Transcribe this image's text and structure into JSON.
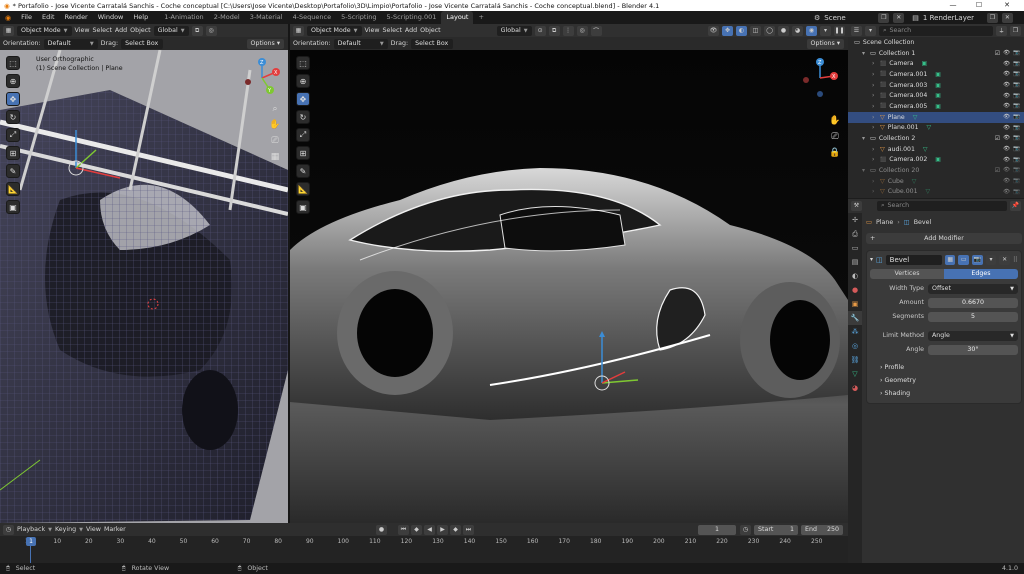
{
  "window": {
    "title": "* Portafolio - Jose Vicente Carratalá Sanchis - Coche conceptual [C:\\Users\\Jose Vicente\\Desktop\\Portafolio\\3D\\Limpio\\Portafolio - Jose Vicente Carratalá Sanchis - Coche conceptual.blend] - Blender 4.1"
  },
  "menu": [
    "File",
    "Edit",
    "Render",
    "Window",
    "Help"
  ],
  "workspaces": [
    "1-Animation",
    "2-Model",
    "3-Material",
    "4-Sequence",
    "5-Scripting",
    "5-Scripting.001",
    "Layout"
  ],
  "active_workspace": "Layout",
  "scene": "Scene",
  "view_layer": "1 RenderLayer",
  "left_viewport": {
    "mode": "Object Mode",
    "view": "View",
    "select": "Select",
    "add": "Add",
    "object": "Object",
    "orientation_label": "Orientation:",
    "orientation": "Default",
    "drag_label": "Drag:",
    "drag": "Select Box",
    "transform": "Global",
    "options": "Options",
    "overlay_title": "User Orthographic",
    "overlay_sub": "(1) Scene Collection | Plane"
  },
  "right_viewport": {
    "mode": "Object Mode",
    "view": "View",
    "select": "Select",
    "add": "Add",
    "object": "Object",
    "orientation_label": "Orientation:",
    "orientation": "Default",
    "drag_label": "Drag:",
    "drag": "Select Box",
    "transform": "Global",
    "options": "Options"
  },
  "outliner": {
    "search_placeholder": "Search",
    "root": "Scene Collection",
    "rows": [
      {
        "name": "Collection 1",
        "type": "collection",
        "indent": 1
      },
      {
        "name": "Camera",
        "type": "camera",
        "indent": 2
      },
      {
        "name": "Camera.001",
        "type": "camera",
        "indent": 2
      },
      {
        "name": "Camera.003",
        "type": "camera",
        "indent": 2
      },
      {
        "name": "Camera.004",
        "type": "camera",
        "indent": 2
      },
      {
        "name": "Camera.005",
        "type": "camera",
        "indent": 2
      },
      {
        "name": "Plane",
        "type": "mesh",
        "indent": 2,
        "selected": true
      },
      {
        "name": "Plane.001",
        "type": "mesh",
        "indent": 2
      },
      {
        "name": "Collection 2",
        "type": "collection",
        "indent": 1
      },
      {
        "name": "audi.001",
        "type": "mesh",
        "indent": 2
      },
      {
        "name": "Camera.002",
        "type": "camera",
        "indent": 2
      },
      {
        "name": "Collection 20",
        "type": "collection",
        "indent": 1,
        "dim": true
      },
      {
        "name": "Cube",
        "type": "mesh",
        "indent": 2,
        "dim": true
      },
      {
        "name": "Cube.001",
        "type": "mesh",
        "indent": 2,
        "dim": true
      }
    ]
  },
  "properties": {
    "search_placeholder": "Search",
    "breadcrumb_object": "Plane",
    "breadcrumb_modifier": "Bevel",
    "add_modifier": "Add Modifier",
    "modifier_name": "Bevel",
    "tab_vertices": "Vertices",
    "tab_edges": "Edges",
    "width_type_label": "Width Type",
    "width_type": "Offset",
    "amount_label": "Amount",
    "amount": "0.6670",
    "segments_label": "Segments",
    "segments": "5",
    "limit_method_label": "Limit Method",
    "limit_method": "Angle",
    "angle_label": "Angle",
    "angle": "30°",
    "subpanels": [
      "Profile",
      "Geometry",
      "Shading"
    ]
  },
  "timeline": {
    "playback": "Playback",
    "keying": "Keying",
    "view": "View",
    "marker": "Marker",
    "current_frame": "1",
    "start_label": "Start",
    "start": "1",
    "end_label": "End",
    "end": "250",
    "ticks": [
      "1",
      "10",
      "20",
      "30",
      "40",
      "50",
      "60",
      "70",
      "80",
      "90",
      "100",
      "110",
      "120",
      "130",
      "140",
      "150",
      "160",
      "170",
      "180",
      "190",
      "200",
      "210",
      "220",
      "230",
      "240",
      "250"
    ]
  },
  "status": {
    "select": "Select",
    "rotate": "Rotate View",
    "object": "Object",
    "version": "4.1.0"
  },
  "colors": {
    "accent": "#4772b3",
    "selected_row": "#334d80",
    "frame_marker": "#4772b3"
  }
}
